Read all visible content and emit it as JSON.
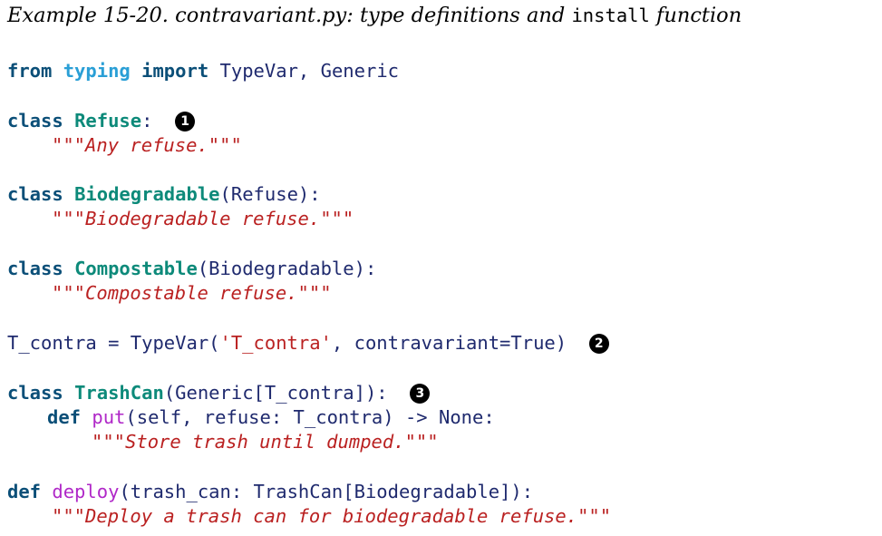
{
  "caption": {
    "prefix": "Example 15-20. contravariant.py: type definitions and ",
    "code_word": "install",
    "suffix": " function"
  },
  "code": {
    "l1": {
      "kw1": "from",
      "mod": "typing",
      "kw2": "import",
      "rest": " TypeVar, Generic"
    },
    "l2": {
      "kw": "class",
      "name": "Refuse",
      "rest": ":",
      "callout": "1"
    },
    "l3": {
      "doc": "\"\"\"Any refuse.\"\"\""
    },
    "l4": {
      "kw": "class",
      "name": "Biodegradable",
      "rest": "(Refuse):"
    },
    "l5": {
      "doc": "\"\"\"Biodegradable refuse.\"\"\""
    },
    "l6": {
      "kw": "class",
      "name": "Compostable",
      "rest": "(Biodegradable):"
    },
    "l7": {
      "doc": "\"\"\"Compostable refuse.\"\"\""
    },
    "l8": {
      "a": "T_contra = TypeVar(",
      "s": "'T_contra'",
      "b": ", contravariant=True)",
      "callout": "2"
    },
    "l9": {
      "kw": "class",
      "name": "TrashCan",
      "rest": "(Generic[T_contra]):",
      "callout": "3"
    },
    "l10": {
      "kw": "def",
      "fn": "put",
      "rest": "(self, refuse: T_contra) -> None:"
    },
    "l11": {
      "doc": "\"\"\"Store trash until dumped.\"\"\""
    },
    "l12": {
      "kw": "def",
      "fn": "deploy",
      "rest": "(trash_can: TrashCan[Biodegradable]):"
    },
    "l13": {
      "doc": "\"\"\"Deploy a trash can for biodegradable refuse.\"\"\""
    }
  }
}
